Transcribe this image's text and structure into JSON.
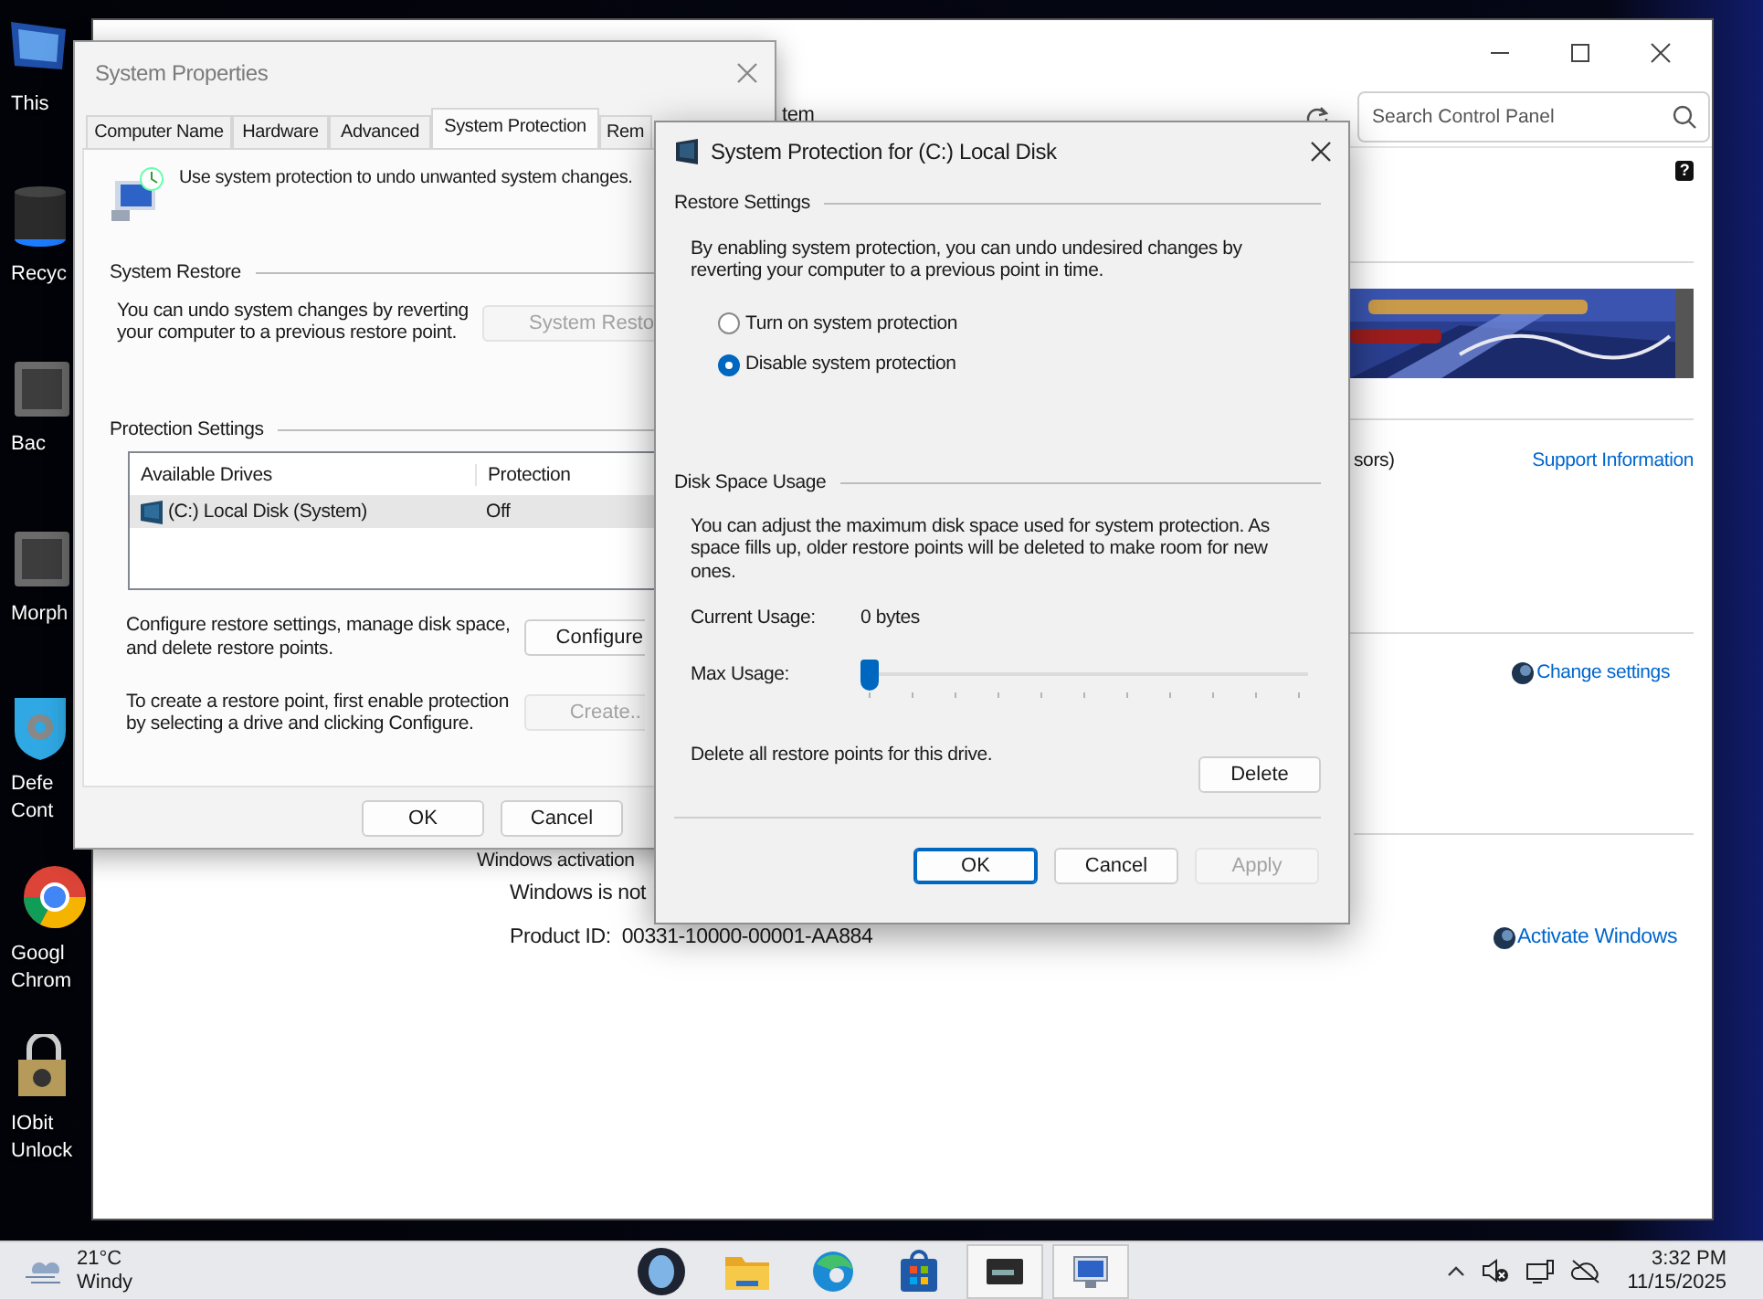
{
  "desktop_icons": [
    {
      "kind": "monitor",
      "lines": [
        "This"
      ]
    },
    {
      "kind": "bin",
      "lines": [
        "Recyc"
      ]
    },
    {
      "kind": "safe",
      "lines": [
        "Bac"
      ]
    },
    {
      "kind": "safe",
      "lines": [
        "Morph"
      ]
    },
    {
      "kind": "shield",
      "lines": [
        "Defe",
        "Cont"
      ]
    },
    {
      "kind": "browser",
      "lines": [
        "Googl",
        "Chrom"
      ]
    },
    {
      "kind": "lock",
      "lines": [
        "IObit",
        "Unlock"
      ]
    }
  ],
  "control_panel": {
    "address": "tem",
    "search": {
      "placeholder": "Search Control Panel"
    },
    "help": "?",
    "processor_fragment": "sors)",
    "support_link": "Support Information",
    "change_settings_link": "Change settings",
    "activation_heading": "Windows activation",
    "activation_status": "Windows is not",
    "product_id_label": "Product ID:",
    "product_id_value": "00331-10000-00001-AA884",
    "activate_link": "Activate Windows"
  },
  "system_properties": {
    "title": "System Properties",
    "tabs": [
      {
        "label": "Computer Name",
        "selected": false
      },
      {
        "label": "Hardware",
        "selected": false
      },
      {
        "label": "Advanced",
        "selected": false
      },
      {
        "label": "System Protection",
        "selected": true
      },
      {
        "label": "Rem",
        "selected": false
      }
    ],
    "intro": "Use system protection to undo unwanted system changes.",
    "restore_heading": "System Restore",
    "restore_text": "You can undo system changes by reverting your computer to a previous restore point.",
    "restore_button": {
      "label": "System Resto",
      "disabled": true
    },
    "protection_heading": "Protection Settings",
    "columns": [
      "Available Drives",
      "Protection"
    ],
    "rows": [
      {
        "drive": "(C:) Local Disk (System)",
        "protection": "Off",
        "selected": true
      }
    ],
    "configure_text": "Configure restore settings, manage disk space, and delete restore points.",
    "configure_button": {
      "label": "Configure",
      "disabled": false
    },
    "create_text": "To create a restore point, first enable protection by selecting a drive and clicking Configure.",
    "create_button": {
      "label": "Create..",
      "disabled": true
    },
    "buttons": [
      {
        "label": "OK",
        "disabled": false
      },
      {
        "label": "Cancel",
        "disabled": false
      }
    ]
  },
  "dialog": {
    "title": "System Protection for (C:) Local Disk",
    "restore_heading": "Restore Settings",
    "restore_text": "By enabling system protection, you can undo undesired changes by reverting your computer to a previous point in time.",
    "options": [
      {
        "label": "Turn on system protection",
        "selected": false
      },
      {
        "label": "Disable system protection",
        "selected": true
      }
    ],
    "disk_heading": "Disk Space Usage",
    "disk_text": "You can adjust the maximum disk space used for system protection. As space fills up, older restore points will be deleted to make room for new ones.",
    "current_usage_label": "Current Usage:",
    "current_usage_value": "0 bytes",
    "max_usage_label": "Max Usage:",
    "max_usage": {
      "level": 0
    },
    "delete_text": "Delete all restore points for this drive.",
    "delete_button": "Delete",
    "buttons": [
      {
        "label": "OK",
        "default": true,
        "disabled": false
      },
      {
        "label": "Cancel",
        "default": false,
        "disabled": false
      },
      {
        "label": "Apply",
        "default": false,
        "disabled": true
      }
    ]
  },
  "taskbar": {
    "weather": {
      "temperature": "21°C",
      "condition": "Windy"
    },
    "apps": [
      {
        "kind": "round-logo",
        "open": false
      },
      {
        "kind": "folder",
        "open": false
      },
      {
        "kind": "browser",
        "open": false
      },
      {
        "kind": "store",
        "open": false
      },
      {
        "kind": "drive",
        "open": true
      },
      {
        "kind": "monitor",
        "open": true
      }
    ],
    "time": "3:32 PM",
    "date": "11/15/2025"
  }
}
